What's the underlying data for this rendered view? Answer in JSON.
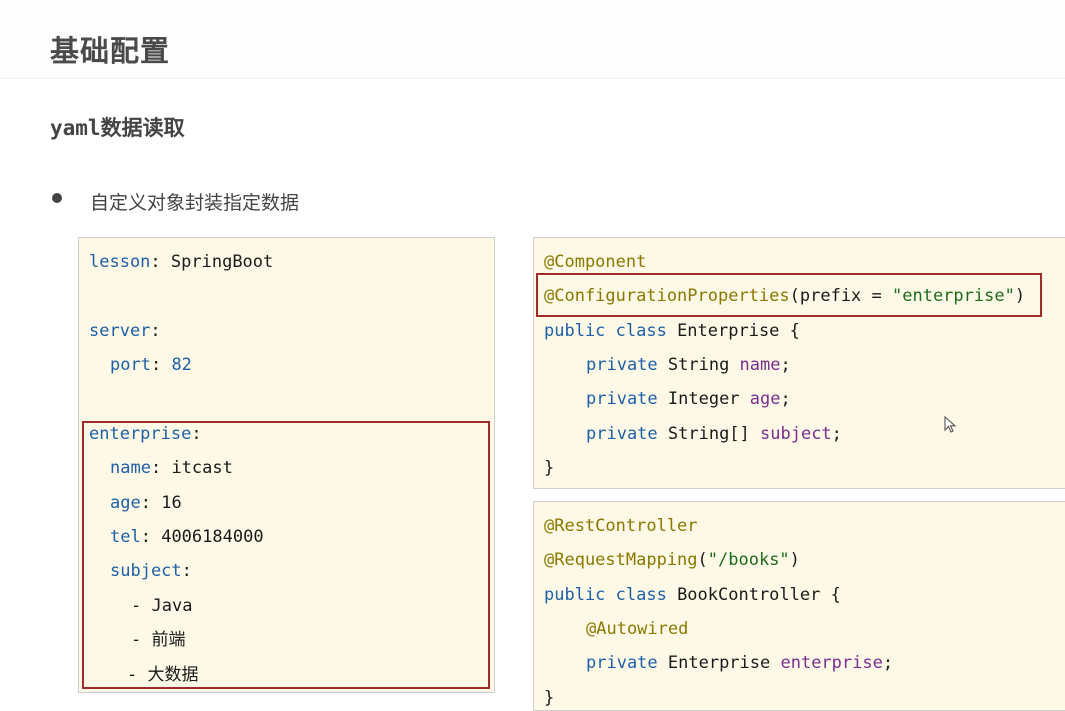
{
  "page": {
    "title": "基础配置",
    "subtitle_code": "yaml",
    "subtitle_text": "数据读取",
    "bullet": "自定义对象封装指定数据"
  },
  "yaml_panel": {
    "lines": [
      {
        "key": "lesson",
        "sep": ": ",
        "value": "SpringBoot"
      },
      {
        "key": "server",
        "sep": ":",
        "value": ""
      },
      {
        "key": "port",
        "sep": ": ",
        "value": "82"
      },
      {
        "key": "enterprise",
        "sep": ":",
        "value": ""
      },
      {
        "key": "name",
        "sep": ": ",
        "value": "itcast"
      },
      {
        "key": "age",
        "sep": ": ",
        "value": "16"
      },
      {
        "key": "tel",
        "sep": ": ",
        "value": "4006184000"
      },
      {
        "key": "subject",
        "sep": ":",
        "value": ""
      },
      {
        "key": "",
        "sep": "- ",
        "value": "Java"
      },
      {
        "key": "",
        "sep": "- ",
        "value": "前端"
      },
      {
        "key": "",
        "sep": "- ",
        "value": "大数据"
      }
    ]
  },
  "java_panel_1": {
    "component": "@Component",
    "config_props": "@ConfigurationProperties",
    "prefix_open": "(prefix = ",
    "prefix_value": "\"enterprise\"",
    "prefix_close": ")",
    "class_kw": "public class ",
    "class_name": "Enterprise {",
    "fields": [
      {
        "mod": "private ",
        "type": "String ",
        "name": "name",
        "end": ";"
      },
      {
        "mod": "private ",
        "type": "Integer ",
        "name": "age",
        "end": ";"
      },
      {
        "mod": "private ",
        "type": "String[] ",
        "name": "subject",
        "end": ";"
      }
    ],
    "close": "}"
  },
  "java_panel_2": {
    "rest": "@RestController",
    "mapping": "@RequestMapping",
    "mapping_open": "(",
    "mapping_value": "\"/books\"",
    "mapping_close": ")",
    "class_kw": "public class ",
    "class_name": "BookController {",
    "autowired": "@Autowired",
    "field_mod": "private ",
    "field_type": "Enterprise ",
    "field_name": "enterprise",
    "field_end": ";",
    "close": "}"
  },
  "colors": {
    "key": "#1d5fa8",
    "annotation": "#8a7800",
    "string": "#1e6b1e",
    "field": "#7a2d8f",
    "highlight": "#a32a2a",
    "panel_bg": "#fdf9e6"
  }
}
